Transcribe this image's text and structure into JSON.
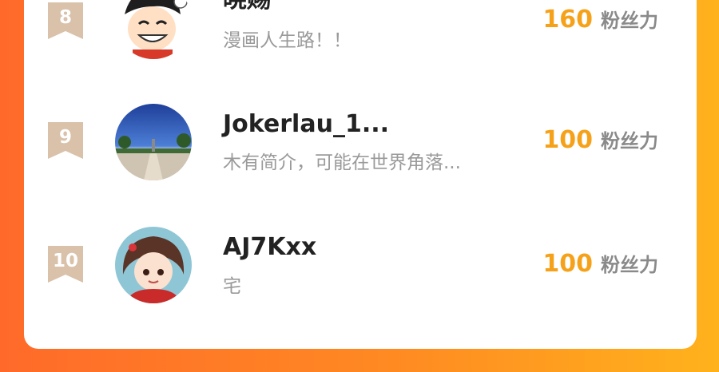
{
  "colors": {
    "accent_score": "#f5a21a",
    "rank_badge": "#d9c1aa",
    "background_from": "#ff6a2a",
    "background_to": "#ffb21c"
  },
  "leaderboard": {
    "rows": [
      {
        "rank": "8",
        "name": "晓赐",
        "bio": "漫画人生路！！",
        "score": "160",
        "unit": "粉丝力"
      },
      {
        "rank": "9",
        "name": "Jokerlau_1...",
        "bio": "木有简介，可能在世界角落...",
        "score": "100",
        "unit": "粉丝力"
      },
      {
        "rank": "10",
        "name": "AJ7Kxx",
        "bio": "宅",
        "score": "100",
        "unit": "粉丝力"
      }
    ]
  }
}
